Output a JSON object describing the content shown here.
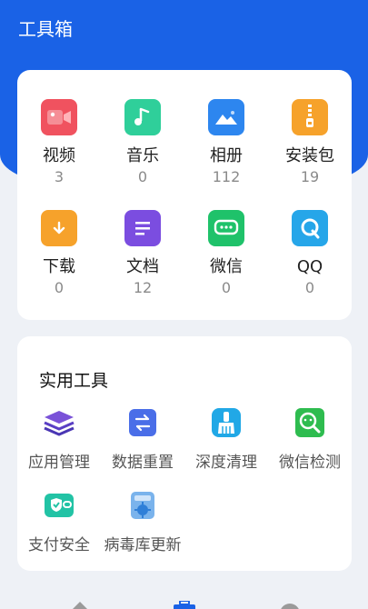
{
  "header": {
    "title": "工具箱"
  },
  "files": [
    {
      "label": "视频",
      "count": "3",
      "icon": "video-icon",
      "color": "#f0525f"
    },
    {
      "label": "音乐",
      "count": "0",
      "icon": "music-icon",
      "color": "#2fcf9a"
    },
    {
      "label": "相册",
      "count": "112",
      "icon": "photo-album-icon",
      "color": "#2d86ef"
    },
    {
      "label": "安装包",
      "count": "19",
      "icon": "package-icon",
      "color": "#f6a22b"
    },
    {
      "label": "下载",
      "count": "0",
      "icon": "download-icon",
      "color": "#f6a22b"
    },
    {
      "label": "文档",
      "count": "12",
      "icon": "document-icon",
      "color": "#7b4de0"
    },
    {
      "label": "微信",
      "count": "0",
      "icon": "wechat-icon",
      "color": "#1fc26a"
    },
    {
      "label": "QQ",
      "count": "0",
      "icon": "qq-icon",
      "color": "#26a6e9"
    }
  ],
  "tools": {
    "title": "实用工具",
    "items": [
      {
        "label": "应用管理",
        "icon": "layers-icon"
      },
      {
        "label": "数据重置",
        "icon": "reset-arrows-icon"
      },
      {
        "label": "深度清理",
        "icon": "broom-icon"
      },
      {
        "label": "微信检测",
        "icon": "wechat-scan-icon"
      },
      {
        "label": "支付安全",
        "icon": "payment-security-icon"
      },
      {
        "label": "病毒库更新",
        "icon": "virus-database-icon"
      }
    ]
  },
  "nav": [
    "home-icon",
    "toolbox-icon",
    "profile-icon"
  ]
}
